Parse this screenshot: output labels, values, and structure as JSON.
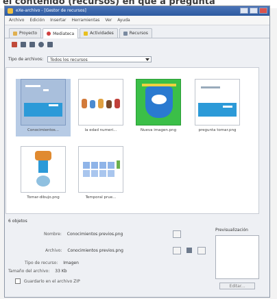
{
  "caption_fragment": "el contenido (recursos) en que a pregunta",
  "window": {
    "title": "eXe-archivo - [Gestor de recursos]",
    "controls": [
      "minimize",
      "maximize",
      "close"
    ]
  },
  "menu": [
    "Archivo",
    "Edición",
    "Insertar",
    "Herramientas",
    "Ver",
    "Ayuda"
  ],
  "tabs": [
    {
      "label": "Proyecto",
      "icon": "folder-icon",
      "active": false
    },
    {
      "label": "Mediateca",
      "icon": "media-icon",
      "active": true
    },
    {
      "label": "Actividades",
      "icon": "star-icon",
      "active": false
    },
    {
      "label": "Recursos",
      "icon": "pencil-icon",
      "active": false
    }
  ],
  "toolbar_icons": [
    "image-icon",
    "sound-icon",
    "text-icon",
    "link-icon",
    "frame-icon"
  ],
  "filter": {
    "label": "Tipo de archivos:",
    "value": "Todos los recursos"
  },
  "items": [
    {
      "caption": "Conocimientos...",
      "kind": "blue-doc",
      "selected": true
    },
    {
      "caption": "la edad numeri...",
      "kind": "characters",
      "selected": false
    },
    {
      "caption": "Nueva imagen.png",
      "kind": "green-logo",
      "selected": false
    },
    {
      "caption": "pregunta tomar.png",
      "kind": "blue-doc",
      "selected": false
    },
    {
      "caption": "Tomar-dibujo.png",
      "kind": "figure",
      "selected": false
    },
    {
      "caption": "Temporal prue...",
      "kind": "table",
      "selected": false
    }
  ],
  "count": "6 objetos",
  "details": {
    "name_label": "Nombre:",
    "name_value": "Conocimientos previos.png",
    "file_label": "Archivo:",
    "file_value": "Conocimientos previos.png",
    "type_label": "Tipo de recurso:",
    "type_value": "Imagen",
    "size_label": "Tamaño del archivo:",
    "size_value": "33 Kb",
    "zip_label": "Guardarlo en el archivo ZIP"
  },
  "preview": {
    "label": "Previsualización",
    "button": "Editar..."
  },
  "colors": {
    "titlebar": "#2d5aa0",
    "selection": "#b7cbe5",
    "accent_green": "#3bbf48",
    "accent_blue": "#2c9ad8"
  }
}
